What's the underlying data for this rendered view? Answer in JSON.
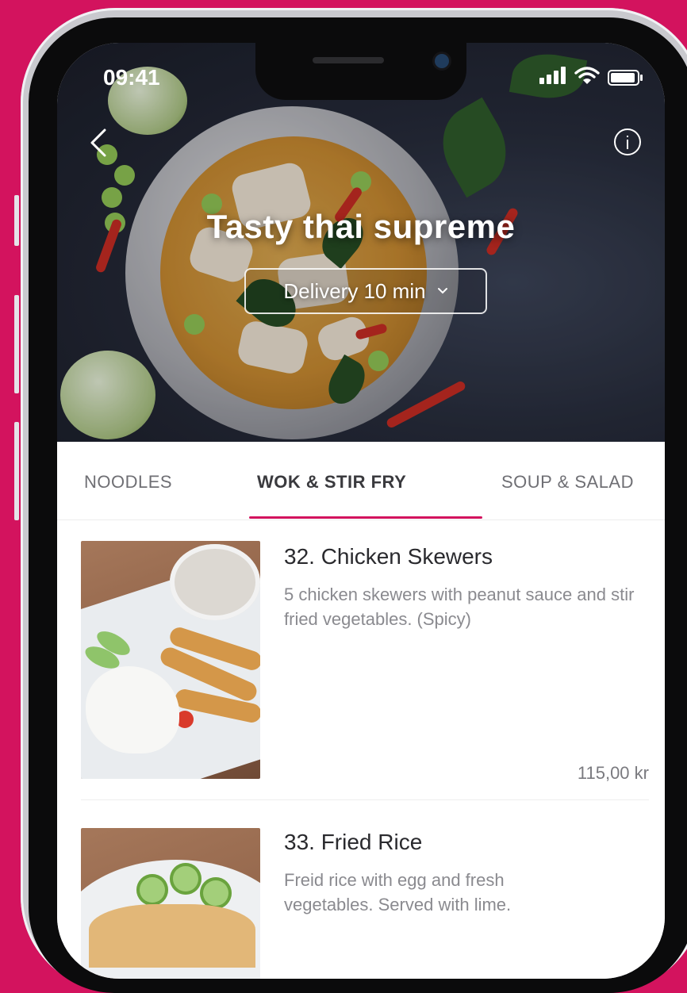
{
  "status_bar": {
    "time": "09:41"
  },
  "restaurant": {
    "name": "Tasty thai supreme",
    "delivery_label": "Delivery 10 min"
  },
  "tabs": [
    {
      "label": "NOODLES",
      "active": false
    },
    {
      "label": "WOK & STIR FRY",
      "active": true
    },
    {
      "label": "SOUP & SALAD",
      "active": false
    }
  ],
  "menu_items": [
    {
      "name": "32. Chicken Skewers",
      "description": "5 chicken skewers with peanut sauce and stir fried vegetables. (Spicy)",
      "price": "115,00 kr"
    },
    {
      "name": "33. Fried Rice",
      "description": "Freid rice with egg and fresh vegetables. Served with lime."
    }
  ],
  "colors": {
    "accent": "#d3135e",
    "background": "#d3135e"
  },
  "icons": {
    "back": "chevron-left-icon",
    "info": "info-icon",
    "signal": "cellular-signal-icon",
    "wifi": "wifi-icon",
    "battery": "battery-icon",
    "delivery_dropdown": "chevron-down-icon"
  }
}
